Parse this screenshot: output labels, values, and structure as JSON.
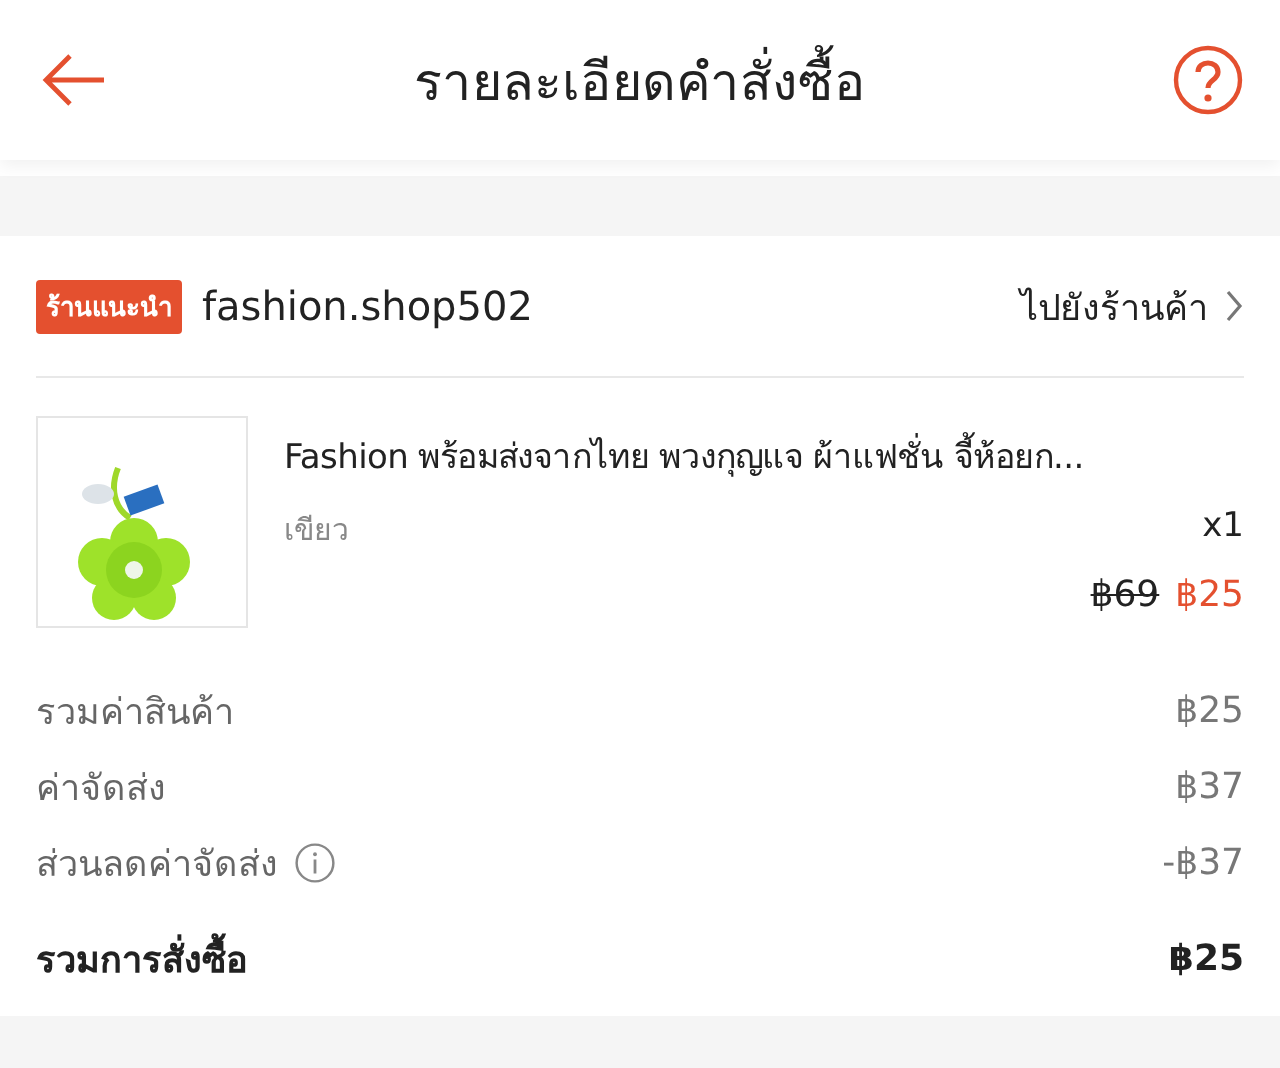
{
  "header": {
    "title": "รายละเอียดคำสั่งซื้อ"
  },
  "shop": {
    "badge": "ร้านแนะนำ",
    "name": "fashion.shop502",
    "link": "ไปยังร้านค้า"
  },
  "product": {
    "name": "Fashion พร้อมส่งจากไทย พวงกุญแจ ผ้าแฟชั่น จี้ห้อยก...",
    "variant": "เขียว",
    "quantity": "x1",
    "original_price": "฿69",
    "price": "฿25"
  },
  "summary": [
    {
      "label": "รวมค่าสินค้า",
      "value": "฿25",
      "info": false,
      "bold": false
    },
    {
      "label": "ค่าจัดส่ง",
      "value": "฿37",
      "info": false,
      "bold": false
    },
    {
      "label": "ส่วนลดค่าจัดส่ง",
      "value": "-฿37",
      "info": true,
      "bold": false
    },
    {
      "label": "รวมการสั่งซื้อ",
      "value": "฿25",
      "info": false,
      "bold": true
    }
  ]
}
